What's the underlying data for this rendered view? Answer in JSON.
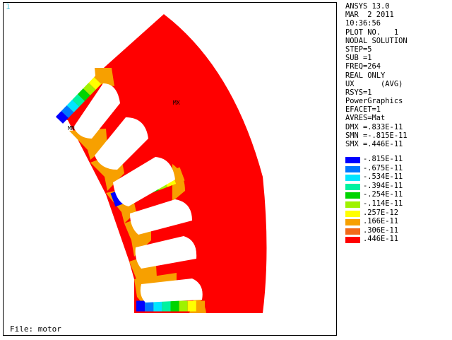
{
  "window": {
    "number": "1",
    "file_label": "File: motor"
  },
  "markers": {
    "max": "MX",
    "min": "MN"
  },
  "info_lines": [
    "ANSYS 13.0",
    "MAR  2 2011",
    "10:36:56",
    "PLOT NO.   1",
    "NODAL SOLUTION",
    "STEP=5",
    "SUB =1",
    "FREQ=264",
    "REAL ONLY",
    "UX      (AVG)",
    "RSYS=1",
    "PowerGraphics",
    "EFACET=1",
    "AVRES=Mat",
    "DMX =.833E-11",
    "SMN =-.815E-11",
    "SMX =.446E-11"
  ],
  "legend": [
    {
      "label": "-.815E-11",
      "color": "#0000ff"
    },
    {
      "label": "-.675E-11",
      "color": "#0077ff"
    },
    {
      "label": "-.534E-11",
      "color": "#00e5ff"
    },
    {
      "label": "-.394E-11",
      "color": "#00f2a0"
    },
    {
      "label": "-.254E-11",
      "color": "#00d400"
    },
    {
      "label": "-.114E-11",
      "color": "#9ff200"
    },
    {
      "label": ".257E-12",
      "color": "#ffff00"
    },
    {
      "label": ".166E-11",
      "color": "#f7a000"
    },
    {
      "label": ".306E-11",
      "color": "#f26a1a"
    },
    {
      "label": ".446E-11",
      "color": "#ff0000"
    }
  ],
  "colors": {
    "body": "#ff0000",
    "tooth": "#f7a000"
  }
}
